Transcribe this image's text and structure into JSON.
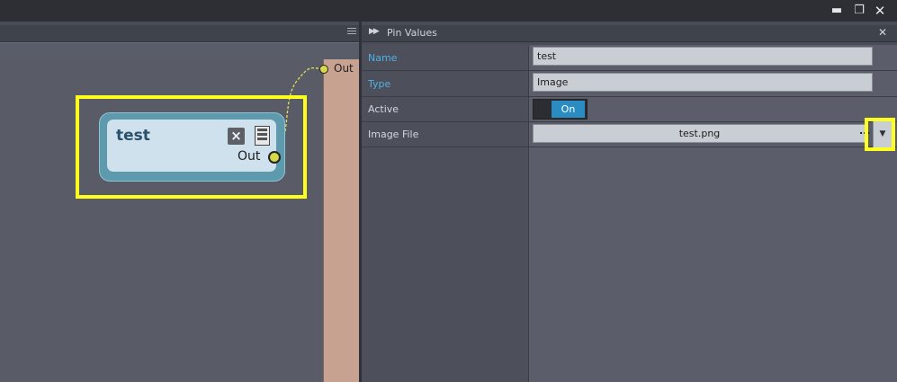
{
  "window": {
    "minimize_icon": "minimize-icon",
    "restore_icon": "restore-icon",
    "close_icon": "close-icon"
  },
  "graph": {
    "outer_out_label": "Out",
    "node": {
      "title": "test",
      "out_label": "Out"
    }
  },
  "pin_values": {
    "title": "Pin Values",
    "rows": [
      {
        "label": "Name",
        "value": "test"
      },
      {
        "label": "Type",
        "value": "Image"
      },
      {
        "label": "Active",
        "value": "On"
      },
      {
        "label": "Image File",
        "value": "test.png",
        "browse": "..."
      }
    ]
  },
  "colors": {
    "accent_blue": "#4fb2e4",
    "toggle_on": "#2a8cc0",
    "highlight": "#ffff1f",
    "node_title": "#2c5069"
  }
}
